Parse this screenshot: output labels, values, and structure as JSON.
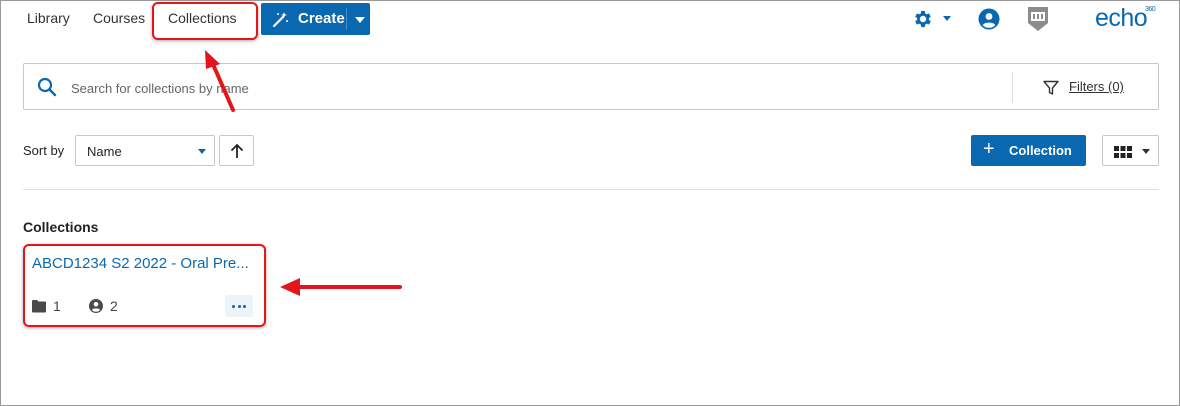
{
  "nav": {
    "library": "Library",
    "courses": "Courses",
    "collections": "Collections",
    "create": "Create"
  },
  "logo": {
    "text": "echo",
    "sup": "360"
  },
  "search": {
    "placeholder": "Search for collections by name",
    "filters": "Filters (0)"
  },
  "sort": {
    "label": "Sort by",
    "selected": "Name"
  },
  "actions": {
    "add_collection": "Collection"
  },
  "section_title": "Collections",
  "collections": [
    {
      "title": "ABCD1234 S2 2022 - Oral Pre...",
      "media_count": "1",
      "member_count": "2"
    }
  ],
  "icons": [
    "wand-icon",
    "gear-icon",
    "user-icon",
    "badge-icon",
    "search-icon",
    "filter-icon",
    "sort-up-icon",
    "plus-icon",
    "grid-view-icon",
    "folder-icon",
    "member-icon",
    "more-icon"
  ],
  "colors": {
    "accent": "#0a68b0",
    "annotation": "#e2161b"
  }
}
